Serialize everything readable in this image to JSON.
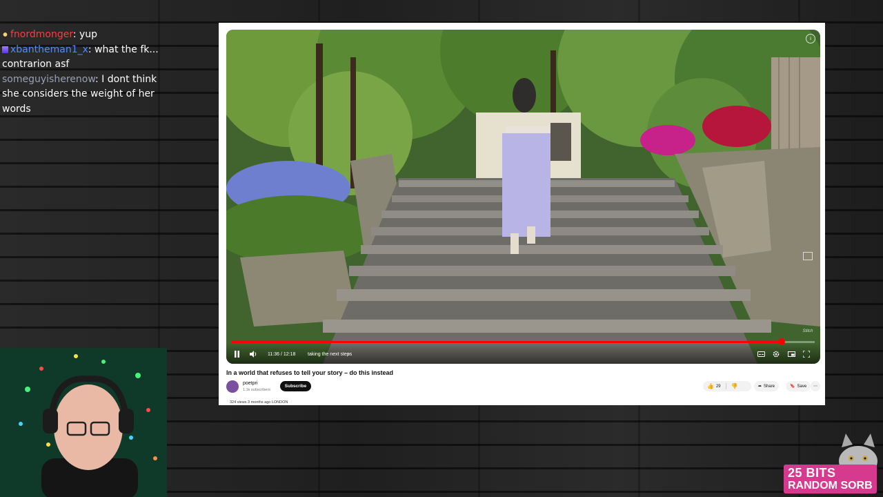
{
  "chat": {
    "messages": [
      {
        "user": "fnordmonger",
        "text": ": yup",
        "color": "#ff3b3b"
      },
      {
        "user": "xbantheman1_x",
        "text": ": what the fk... contrarion asf",
        "color": "#4f8cff"
      },
      {
        "user": "someguyisherenow",
        "text": ": I dont think she considers the weight of her words",
        "color": "#9aa0b5"
      }
    ]
  },
  "player": {
    "time": "11:36 / 12:18",
    "chapter": "taking the next steps",
    "progress": 0.943,
    "watermark": "Stitch"
  },
  "video": {
    "title": "In a world that refuses to tell your story – do this instead",
    "channel": "poetpri",
    "subscribers": "1.1k subscribers",
    "subscribe_label": "Subscribe",
    "likes": "29",
    "share_label": "Share",
    "save_label": "Save",
    "meta": "324 views  3 months ago  LONDON"
  },
  "overlay": {
    "bits_line1": "25 BITS",
    "bits_line2": "RANDOM SORB",
    "accent": "#d63a8f"
  }
}
